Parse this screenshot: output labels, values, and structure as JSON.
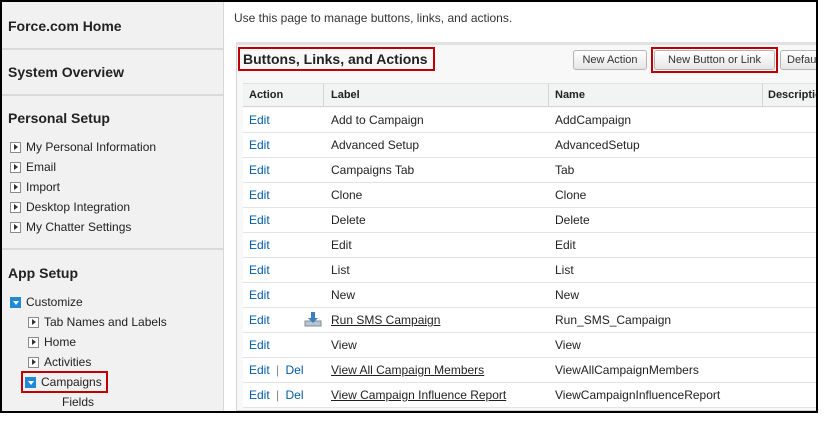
{
  "sidebar": {
    "force_home": "Force.com Home",
    "system_overview": "System Overview",
    "personal_setup": {
      "title": "Personal Setup",
      "items": [
        "My Personal Information",
        "Email",
        "Import",
        "Desktop Integration",
        "My Chatter Settings"
      ]
    },
    "app_setup": {
      "title": "App Setup",
      "customize": "Customize",
      "sub_items": [
        "Tab Names and Labels",
        "Home",
        "Activities"
      ],
      "campaigns": "Campaigns",
      "fields": "Fields"
    }
  },
  "main": {
    "intro": "Use this page to manage buttons, links, and actions.",
    "panel_title": "Buttons, Links, and Actions",
    "buttons": {
      "new_action": "New Action",
      "new_button_or_link": "New Button or Link",
      "default_partial": "Defau"
    },
    "columns": [
      "Action",
      "Label",
      "Name",
      "Descriptio"
    ],
    "rows": [
      {
        "action": "Edit",
        "label": "Add to Campaign",
        "name": "AddCampaign"
      },
      {
        "action": "Edit",
        "label": "Advanced Setup",
        "name": "AdvancedSetup"
      },
      {
        "action": "Edit",
        "label": "Campaigns Tab",
        "name": "Tab"
      },
      {
        "action": "Edit",
        "label": "Clone",
        "name": "Clone"
      },
      {
        "action": "Edit",
        "label": "Delete",
        "name": "Delete"
      },
      {
        "action": "Edit",
        "label": "Edit",
        "name": "Edit"
      },
      {
        "action": "Edit",
        "label": "List",
        "name": "List"
      },
      {
        "action": "Edit",
        "label": "New",
        "name": "New"
      },
      {
        "action": "Edit",
        "label": "Run SMS Campaign",
        "name": "Run_SMS_Campaign"
      },
      {
        "action": "Edit",
        "label": "View",
        "name": "View"
      },
      {
        "action": "Edit",
        "action2": "Del",
        "label": "View All Campaign Members",
        "name": "ViewAllCampaignMembers"
      },
      {
        "action": "Edit",
        "action2": "Del",
        "label": "View Campaign Influence Report",
        "name": "ViewCampaignInfluenceReport"
      }
    ],
    "action_sep": "|"
  },
  "colors": {
    "link": "#015ba7",
    "highlight": "#c00000",
    "expand_icon": "#1f8bd6"
  }
}
